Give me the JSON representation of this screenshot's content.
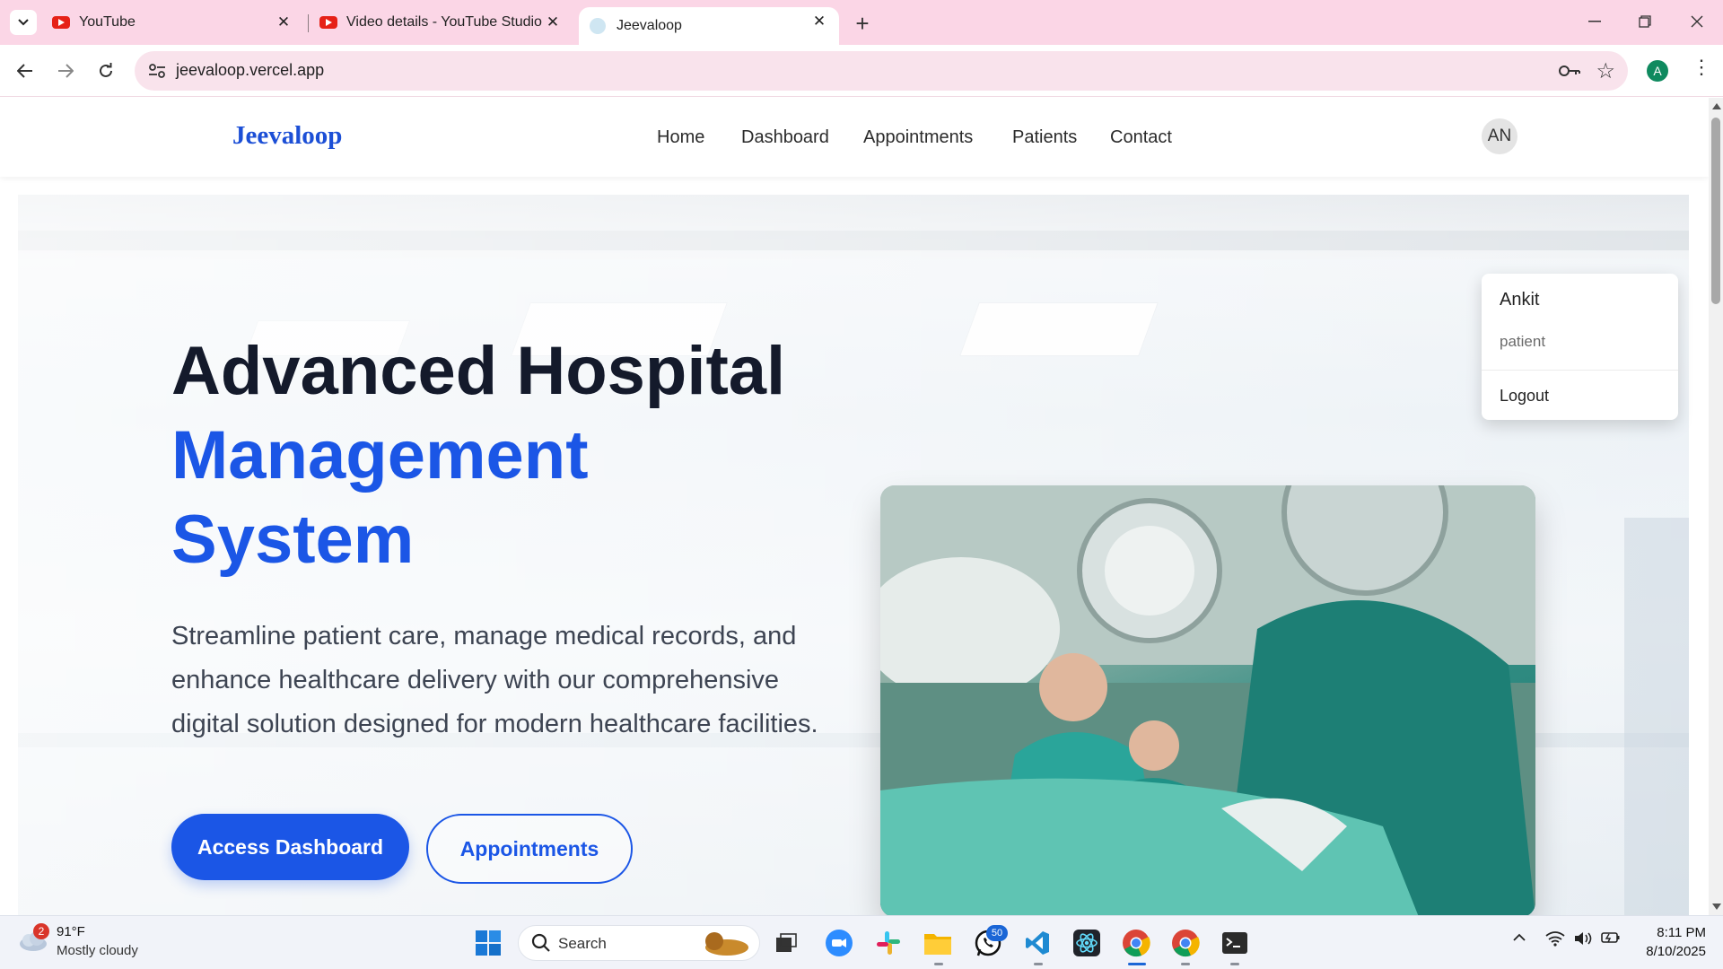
{
  "browser": {
    "tabs": [
      {
        "title": "YouTube"
      },
      {
        "title": "Video details - YouTube Studio"
      },
      {
        "title": "Jeevaloop"
      }
    ],
    "url": "jeevaloop.vercel.app",
    "profile_initial": "A"
  },
  "site": {
    "brand": "Jeevaloop",
    "nav": [
      "Home",
      "Dashboard",
      "Appointments",
      "Patients",
      "Contact"
    ],
    "avatar_initials": "AN",
    "user_menu": {
      "name": "Ankit",
      "role": "patient",
      "logout": "Logout"
    }
  },
  "hero": {
    "title_line1": "Advanced Hospital",
    "title_line2": "Management",
    "title_line3": "System",
    "description": "Streamline patient care, manage medical records, and enhance healthcare delivery with our comprehensive digital solution designed for modern healthcare facilities.",
    "primary_button": "Access Dashboard",
    "secondary_button": "Appointments"
  },
  "taskbar": {
    "weather_badge": "2",
    "weather_temp": "91°F",
    "weather_desc": "Mostly cloudy",
    "search_label": "Search",
    "whatsapp_badge": "50",
    "time": "8:11 PM",
    "date": "8/10/2025"
  },
  "colors": {
    "accent": "#1b56e6",
    "tab_strip": "#fbd6e6",
    "heading": "#141a2b"
  }
}
